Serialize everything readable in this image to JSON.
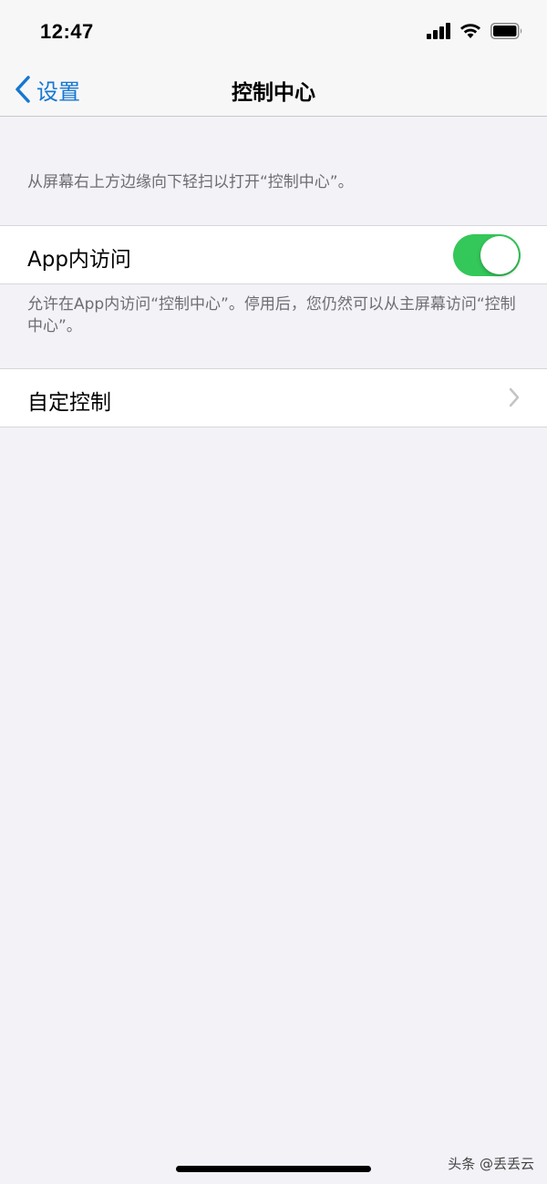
{
  "status_bar": {
    "time": "12:47",
    "icons": [
      "cellular-signal-icon",
      "wifi-icon",
      "battery-icon"
    ]
  },
  "nav": {
    "back_label": "设置",
    "title": "控制中心"
  },
  "sections": {
    "header_note": "从屏幕右上方边缘向下轻扫以打开“控制中心”。",
    "in_app_access": {
      "label": "App内访问",
      "enabled": true
    },
    "in_app_note": "允许在App内访问“控制中心”。停用后，您仍然可以从主屏幕访问“控制中心”。",
    "customize": {
      "label": "自定控制"
    }
  },
  "watermark": "头条 @丢丢云",
  "colors": {
    "accent": "#1677d1",
    "toggle_on": "#34c759",
    "background": "#f2f2f7",
    "secondary_text": "#6d6d72"
  }
}
